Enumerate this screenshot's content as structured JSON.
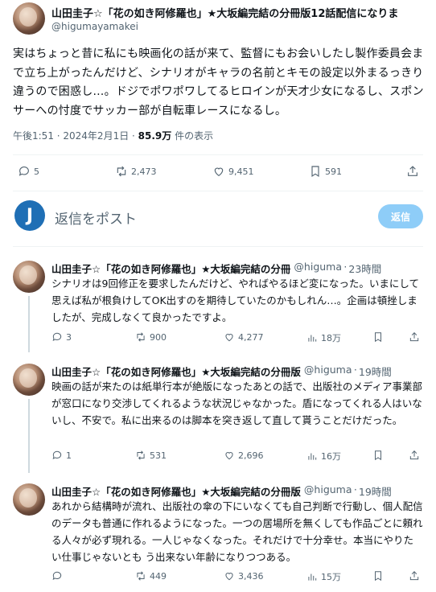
{
  "main_tweet": {
    "name": "山田圭子☆「花の如き阿修羅也」★大坂編完結の分冊版12話配信になりま",
    "handle": "@higumayamakei",
    "text": "実はちょっと昔に私にも映画化の話が来て、監督にもお会いしたし製作委員会まで立ち上がったんだけど、シナリオがキャラの名前とキモの設定以外まるっきり違うので困惑し…。ドジでポワポワしてるヒロインが天才少女になるし、スポンサーへの忖度でサッカー部が自転車レースになるし。",
    "time": "午後1:51 · 2024年2月1日 · ",
    "views_count": "85.9万",
    "views_label": " 件の表示",
    "actions": {
      "replies": "5",
      "reposts": "2,473",
      "likes": "9,451",
      "bookmarks": "591"
    }
  },
  "reply_box": {
    "avatar_letter": "J",
    "placeholder": "返信をポスト",
    "button_label": "返信"
  },
  "replies": [
    {
      "name": "山田圭子☆「花の如き阿修羅也」★大坂編完結の分冊",
      "handle": "@higumayamakei",
      "time": "23時間",
      "text": "シナリオは9回修正を要求したんだけど、やればやるほど変になった。いまにして思えば私が根負けしてOK出すのを期待していたのかもしれん…。企画は頓挫しましたが、完成しなくて良かったですよ。",
      "replies": "3",
      "reposts": "900",
      "likes": "4,277",
      "views": "18万"
    },
    {
      "name": "山田圭子☆「花の如き阿修羅也」★大坂編完結の分冊版",
      "handle": "@higumayamakei",
      "time": "19時間",
      "text": "映画の話が来たのは紙単行本が絶版になったあとの話で、出版社のメディア事業部が窓口になり交渉してくれるような状況じゃなかった。盾になってくれる人はいないし、不安で。私に出来るのは脚本を突き返して直して貰うことだけだった。",
      "replies": "1",
      "reposts": "531",
      "likes": "2,696",
      "views": "16万"
    },
    {
      "name": "山田圭子☆「花の如き阿修羅也」★大坂編完結の分冊版",
      "handle": "@higumayamakei",
      "time": "19時間",
      "text": "あれから結構時が流れ、出版社の傘の下にいなくても自己判断で行動し、個人配信のデータも普通に作れるようになった。一つの居場所を無くしても作品ごとに頼れる人々が必ず現れる。一人じゃなくなった。それだけで十分幸せ。本当にやりたい仕事じゃないとも う出来ない年齢になりつつある。",
      "replies": "",
      "reposts": "449",
      "likes": "3,436",
      "views": "15万"
    }
  ]
}
